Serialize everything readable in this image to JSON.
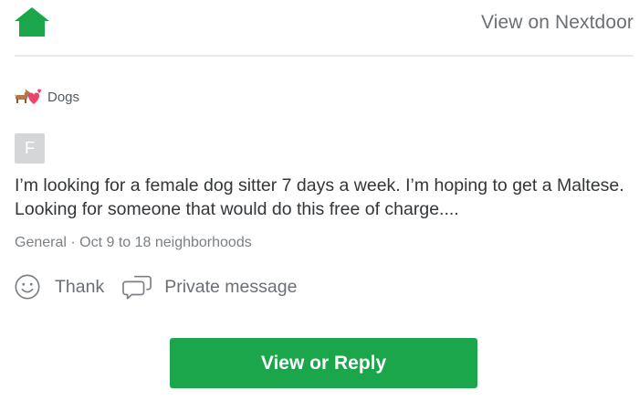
{
  "header": {
    "logo_icon": "house-icon",
    "brand_color": "#1ca64b",
    "view_link": "View on Nextdoor"
  },
  "post": {
    "category": {
      "icon": "dog-heart-icon",
      "label": "Dogs"
    },
    "author": {
      "initial": "F"
    },
    "body": "I’m looking for a female dog sitter 7 days a week. I’m hoping to get a Maltese. Looking for someone that would do this free of charge....",
    "meta": "General · Oct 9 to 18 neighborhoods",
    "actions": {
      "thank": {
        "icon": "smiley-icon",
        "label": "Thank"
      },
      "message": {
        "icon": "chat-bubbles-icon",
        "label": "Private message"
      }
    }
  },
  "cta": {
    "label": "View or Reply",
    "color": "#1ca64b"
  }
}
